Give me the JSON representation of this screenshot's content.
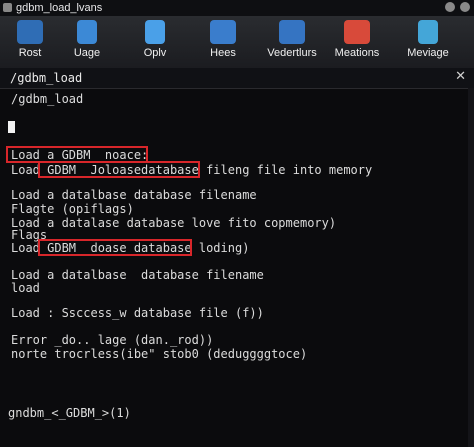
{
  "window": {
    "title": "gdbm_load_lvans"
  },
  "dock": {
    "items": [
      {
        "label": "Rost",
        "icon": "folder-icon",
        "color": "#2f6db5"
      },
      {
        "label": "Uage",
        "icon": "document-icon",
        "color": "#3c89d6"
      },
      {
        "label": "Oplv",
        "icon": "document-icon",
        "color": "#4aa0e8"
      },
      {
        "label": "Hees",
        "icon": "folder-icon",
        "color": "#3a7dcc"
      },
      {
        "label": "Vedertlurs",
        "icon": "folder-icon",
        "color": "#3574c2"
      },
      {
        "label": "Meations",
        "icon": "toolbox-icon",
        "color": "#d84a3a"
      },
      {
        "label": "Meviage",
        "icon": "user-badge-icon",
        "color": "#44a6d8"
      }
    ]
  },
  "terminal": {
    "title": "/gdbm_load",
    "lines": [
      "/gdbm_load",
      "Load a GDBM _noace:",
      "Load GDBM _Joloasedatabase fileng file into memory",
      "Load a datalbase database filename",
      "Flagte (opiflags)",
      "Load a datalase database love fito copmemory)",
      "Flags",
      "Load GDBM _doase_database loding)",
      "Load a datalbase  database filename",
      "load",
      "Load : Ssccess_w database file (f))",
      "Error _do.. lage (dan._rod))",
      "norte trocrless(ibe\" stob0 (deduggggtoce)",
      "gndbm_<_GDBM_>(1)"
    ]
  },
  "colors": {
    "highlight": "#d8262a",
    "text": "#dcdcdc",
    "background": "#0b0b0d"
  }
}
